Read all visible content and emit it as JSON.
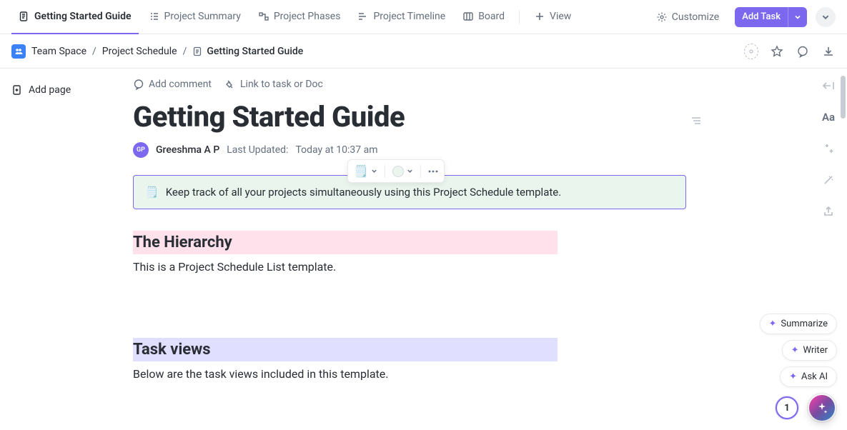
{
  "tabs": [
    {
      "label": "Getting Started Guide",
      "icon": "doc-list-icon",
      "active": true
    },
    {
      "label": "Project Summary",
      "icon": "list-icon",
      "active": false
    },
    {
      "label": "Project Phases",
      "icon": "phases-icon",
      "active": false
    },
    {
      "label": "Project Timeline",
      "icon": "timeline-icon",
      "active": false
    },
    {
      "label": "Board",
      "icon": "board-icon",
      "active": false
    }
  ],
  "view_btn": "View",
  "customize_label": "Customize",
  "add_task_label": "Add Task",
  "breadcrumb": {
    "space": "Team Space",
    "list": "Project Schedule",
    "doc": "Getting Started Guide"
  },
  "left": {
    "add_page": "Add page"
  },
  "doc_actions": {
    "add_comment": "Add comment",
    "link_task": "Link to task or Doc"
  },
  "doc": {
    "title": "Getting Started Guide",
    "author_initials": "GP",
    "author": "Greeshma A P",
    "updated_label": "Last Updated:",
    "updated_time": "Today at 10:37 am",
    "callout_emoji": "🗒️",
    "callout_text": "Keep track of all your projects simultaneously using this Project Schedule template.",
    "section1_heading": "The Hierarchy",
    "section1_body": "This is a Project Schedule List template.",
    "section2_heading": "Task views",
    "section2_body": "Below are the task views included in this template."
  },
  "rail": {
    "aa_label": "Aa"
  },
  "ai": {
    "summarize": "Summarize",
    "writer": "Writer",
    "ask_ai": "Ask AI"
  },
  "notif_count": "1",
  "colors": {
    "accent": "#7b68ee",
    "pink_hl": "#ffe1eb",
    "lavender_hl": "#e1dfff",
    "callout_bg": "#e9f5ed"
  }
}
